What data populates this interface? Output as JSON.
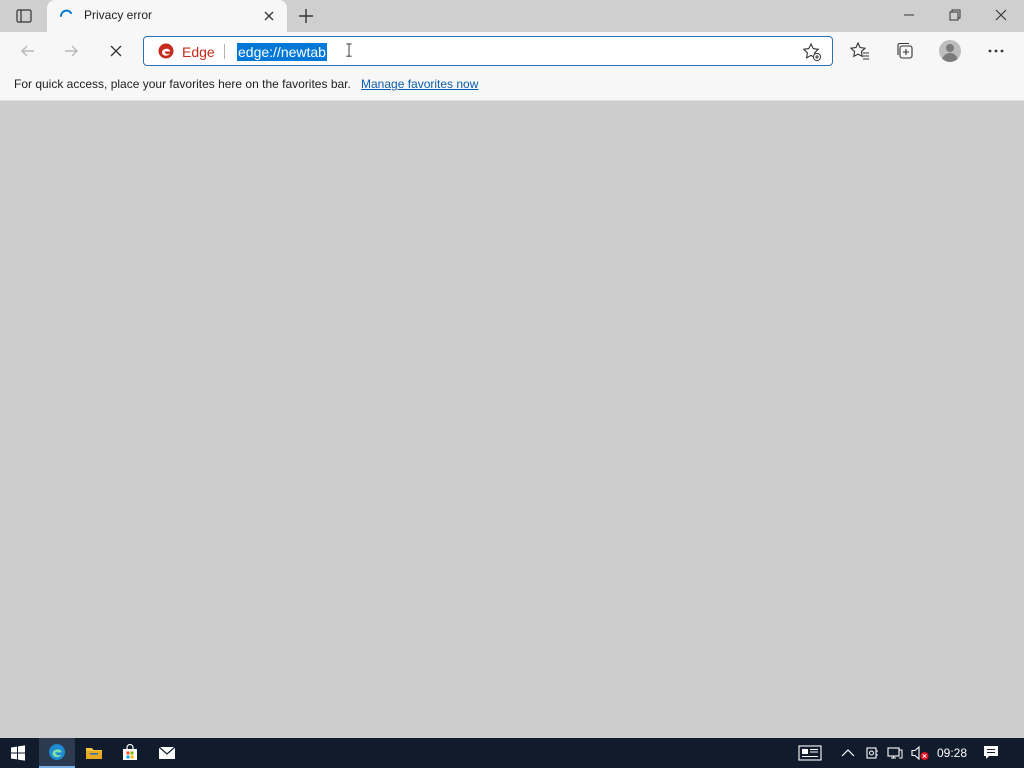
{
  "tab": {
    "title": "Privacy error"
  },
  "toolbar": {
    "site_label": "Edge",
    "url": "edge://newtab"
  },
  "favorites_bar": {
    "message": "For quick access, place your favorites here on the favorites bar.",
    "link": "Manage favorites now"
  },
  "taskbar": {
    "time": "09:28",
    "pinned": [
      "edge-icon",
      "file-explorer-icon",
      "store-icon",
      "mail-icon"
    ]
  },
  "colors": {
    "accent": "#0078d7",
    "edge_brand": "#c42b1c",
    "taskbar": "#101b2b",
    "content_bg": "#cdcdcd"
  }
}
